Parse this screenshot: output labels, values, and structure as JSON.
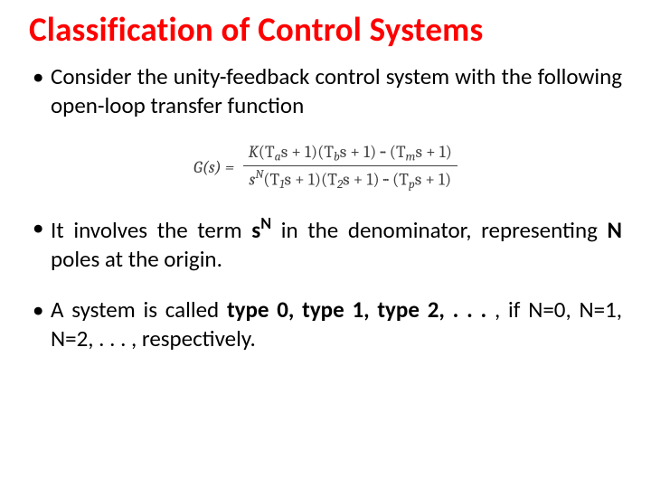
{
  "title": "Classification of Control Systems",
  "bullets": {
    "b1": "Consider the unity-feedback control system with the following open-loop transfer function",
    "b2_pre": "It involves the term ",
    "b2_term_s": "s",
    "b2_term_N": "N",
    "b2_mid": " in the denominator, representing ",
    "b2_N": "N",
    "b2_post": " poles at the origin.",
    "b3_pre": "A system is called ",
    "b3_t0": "type 0, ",
    "b3_t1": "type 1, ",
    "b3_t2": "type 2, ",
    "b3_dots": ". . . ",
    "b3_post": ", if N=0, N=1, N=2, . . . , respectively."
  },
  "equation": {
    "lhs": "G(s) =",
    "num_K": "K",
    "num_f1_pre": "(T",
    "num_f1_sub": "a",
    "num_f1_post": "s + 1)",
    "num_f2_pre": "(T",
    "num_f2_sub": "b",
    "num_f2_post": "s + 1)",
    "num_dots": " ··· ",
    "num_f3_pre": "(T",
    "num_f3_sub": "m",
    "num_f3_post": "s + 1)",
    "den_s": "s",
    "den_N": "N",
    "den_f1_pre": "(T",
    "den_f1_sub": "1",
    "den_f1_post": "s + 1)",
    "den_f2_pre": "(T",
    "den_f2_sub": "2",
    "den_f2_post": "s + 1)",
    "den_dots": " ··· ",
    "den_f3_pre": "(T",
    "den_f3_sub": "p",
    "den_f3_post": "s + 1)"
  }
}
